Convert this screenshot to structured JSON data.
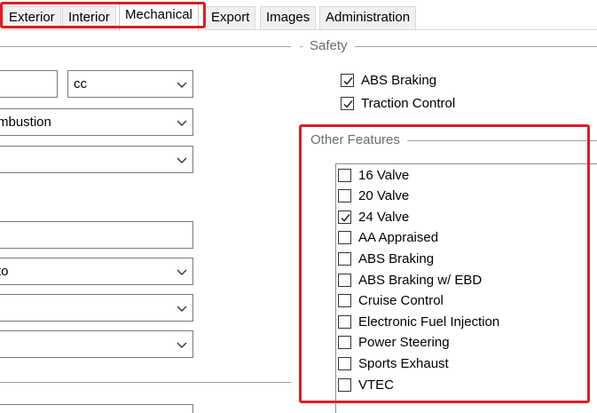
{
  "tabs": [
    {
      "label": "Exterior",
      "active": false
    },
    {
      "label": "Interior",
      "active": false
    },
    {
      "label": "Mechanical",
      "active": true
    },
    {
      "label": "Export",
      "active": false
    },
    {
      "label": "Images",
      "active": false
    },
    {
      "label": "Administration",
      "active": false
    }
  ],
  "form": {
    "engine_size_value": "",
    "engine_unit": "cc",
    "fuel_type": "mbustion",
    "combo3": "",
    "text_field": "",
    "transmission": "to",
    "combo6": "",
    "combo7": "",
    "bottom_field": ""
  },
  "safety": {
    "title": "Safety",
    "items": [
      {
        "label": "ABS Braking",
        "checked": true
      },
      {
        "label": "Traction Control",
        "checked": true
      }
    ]
  },
  "other_features": {
    "title": "Other Features",
    "items": [
      {
        "label": "16 Valve",
        "checked": false
      },
      {
        "label": "20 Valve",
        "checked": false
      },
      {
        "label": "24 Valve",
        "checked": true
      },
      {
        "label": "AA Appraised",
        "checked": false
      },
      {
        "label": "ABS Braking",
        "checked": false
      },
      {
        "label": "ABS Braking w/ EBD",
        "checked": false
      },
      {
        "label": "Cruise Control",
        "checked": false
      },
      {
        "label": "Electronic Fuel Injection",
        "checked": false
      },
      {
        "label": "Power Steering",
        "checked": false
      },
      {
        "label": "Sports Exhaust",
        "checked": false
      },
      {
        "label": "VTEC",
        "checked": false
      }
    ]
  },
  "colors": {
    "highlight": "#e01c24"
  }
}
